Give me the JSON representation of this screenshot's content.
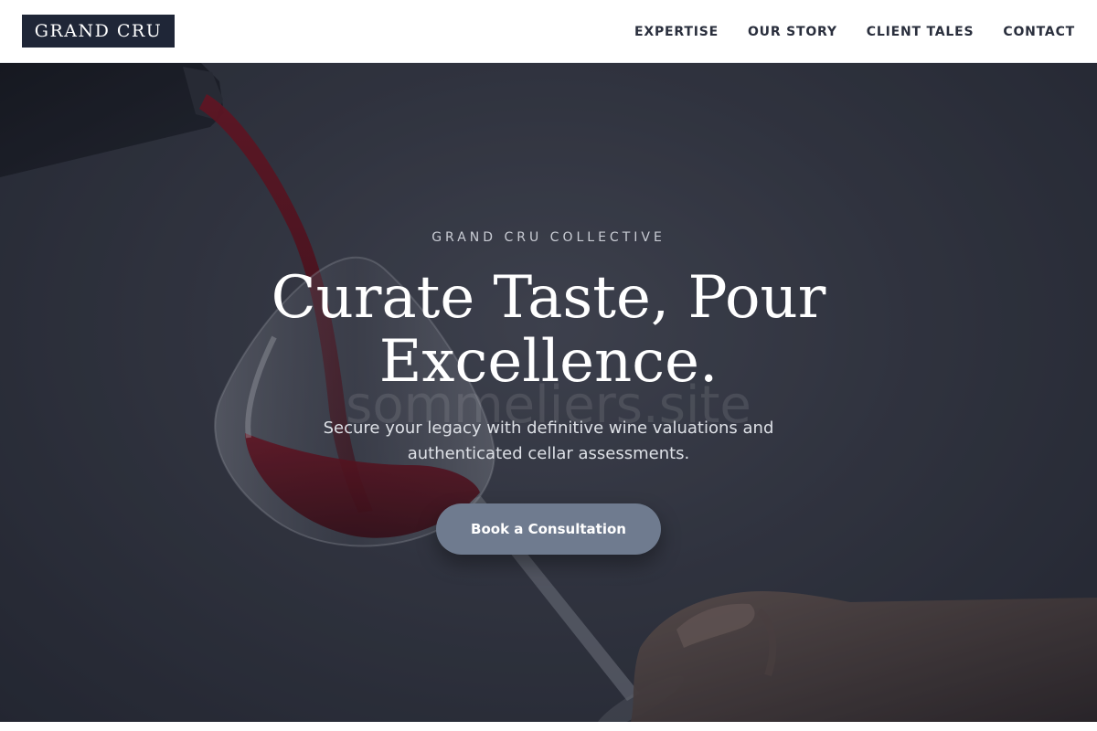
{
  "header": {
    "logo": "GRAND CRU",
    "nav": [
      {
        "label": "EXPERTISE"
      },
      {
        "label": "OUR STORY"
      },
      {
        "label": "CLIENT TALES"
      },
      {
        "label": "CONTACT"
      }
    ]
  },
  "hero": {
    "eyebrow": "GRAND CRU COLLECTIVE",
    "headline": "Curate Taste, Pour Excellence.",
    "subline": "Secure your legacy with definitive wine valuations and authenticated cellar assessments.",
    "cta_label": "Book a Consultation",
    "watermark": "sommeliers.site"
  },
  "colors": {
    "header_bg": "#ffffff",
    "logo_bg": "#1f2637",
    "nav_text": "#2a2f3d",
    "hero_bg": "#383b47",
    "wine": "#6e0f1c",
    "cta_bg": "#6f7b8f"
  }
}
